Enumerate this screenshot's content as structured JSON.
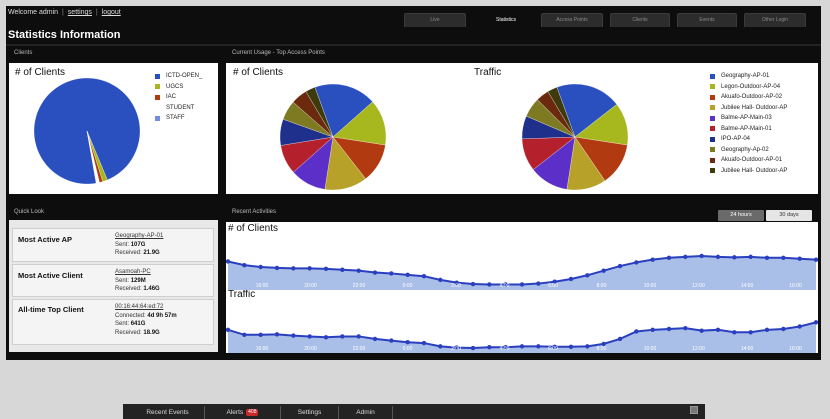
{
  "header": {
    "welcome": "Welcome admin",
    "settings_link": "settings",
    "logout_link": "logout",
    "tabs": [
      {
        "label": "Live",
        "active": false
      },
      {
        "label": "Statistics",
        "active": true
      },
      {
        "label": "Access Points",
        "active": false
      },
      {
        "label": "Clients",
        "active": false
      },
      {
        "label": "Events",
        "active": false
      },
      {
        "label": "Other Login",
        "active": false
      }
    ]
  },
  "page_title": "Statistics Information",
  "panels": {
    "clients_label": "Clients",
    "usage_label": "Current Usage - Top Access Points",
    "quicklook_label": "Quick Look",
    "recent_label": "Recent Activities"
  },
  "quick_look": [
    {
      "label": "Most Active AP",
      "link": "Geography-AP-01",
      "lines": [
        {
          "key": "Sent:",
          "value": "107G"
        },
        {
          "key": "Received:",
          "value": "21.9G"
        }
      ]
    },
    {
      "label": "Most Active Client",
      "link": "Asamoah-PC",
      "lines": [
        {
          "key": "Sent:",
          "value": "129M"
        },
        {
          "key": "Received:",
          "value": "1.46G"
        }
      ]
    },
    {
      "label": "All-time Top Client",
      "link": "00:16:44:64:ed:72",
      "lines": [
        {
          "key": "Connected:",
          "value": "4d 9h 57m"
        },
        {
          "key": "Sent:",
          "value": "641G"
        },
        {
          "key": "Received:",
          "value": "18.9G"
        }
      ]
    }
  ],
  "range_buttons": [
    {
      "label": "24 hours",
      "active": true
    },
    {
      "label": "30 days",
      "active": false
    }
  ],
  "footer": {
    "tabs": [
      "Recent Events",
      "Alerts",
      "Settings",
      "Admin"
    ],
    "alerts_badge": "408"
  },
  "chart_data": [
    {
      "type": "pie",
      "title": "# of Clients",
      "categories": [
        "ICTD-OPEN_",
        "UGCS",
        "IAC",
        "STUDENT",
        "STAFF"
      ],
      "values": [
        96.5,
        1.5,
        1.0,
        0.5,
        0.5
      ],
      "colors": [
        "#2a4fbf",
        "#a7b81e",
        "#b23a10",
        "#ffffff",
        "#ffffff"
      ],
      "legend_colors": [
        "#2a4fbf",
        "#a7b81e",
        "#b23a10",
        "#ffffff",
        "#6f8fe0"
      ],
      "legend": "right"
    },
    {
      "type": "pie",
      "title": "# of Clients",
      "values": [
        19,
        14,
        12,
        13,
        11,
        9,
        8,
        6,
        5,
        3
      ],
      "colors": [
        "#2a4fbf",
        "#a7b81e",
        "#b23a10",
        "#b8a128",
        "#5b2fc8",
        "#b4202c",
        "#1f2f8c",
        "#7e7a22",
        "#6b2a0d",
        "#3e3a0c"
      ],
      "legend": "none"
    },
    {
      "type": "pie",
      "title": "Traffic",
      "categories": [
        "Geography-AP-01",
        "Legon-Outdoor-AP-04",
        "Akuafo-Outdoor-AP-02",
        "Jubilee Hall- Outdoor-AP",
        "Balme-AP-Main-03",
        "Balme-AP-Main-01",
        "IPO-AP-04",
        "Geography-Ap-02",
        "Akuafo-Outdoor-AP-01",
        "Jubilee Hall- Outdoor-AP"
      ],
      "values": [
        20,
        13,
        13,
        12,
        12,
        10,
        7,
        6,
        4,
        3
      ],
      "colors": [
        "#2a4fbf",
        "#a7b81e",
        "#b23a10",
        "#b8a128",
        "#5b2fc8",
        "#b4202c",
        "#1f2f8c",
        "#7e7a22",
        "#6b2a0d",
        "#3e3a0c"
      ],
      "legend": "right"
    },
    {
      "type": "area",
      "title": "# of Clients",
      "x": [
        "16:00",
        "20:00",
        "22:00",
        "0:00",
        "2:00",
        "4:00",
        "6:00",
        "8:00",
        "10:00",
        "12:00",
        "14:00",
        "16:00"
      ],
      "values": [
        0.62,
        0.54,
        0.5,
        0.48,
        0.47,
        0.47,
        0.46,
        0.44,
        0.42,
        0.38,
        0.36,
        0.33,
        0.3,
        0.22,
        0.16,
        0.13,
        0.12,
        0.12,
        0.12,
        0.14,
        0.18,
        0.24,
        0.32,
        0.42,
        0.52,
        0.6,
        0.66,
        0.7,
        0.72,
        0.74,
        0.72,
        0.71,
        0.72,
        0.7,
        0.7,
        0.68,
        0.66
      ],
      "color": "#2a3fbf",
      "fill": "#a9bfe8"
    },
    {
      "type": "area",
      "title": "Traffic",
      "x": [
        "16:00",
        "20:00",
        "22:00",
        "0:00",
        "2:00",
        "4:00",
        "6:00",
        "8:00",
        "10:00",
        "12:00",
        "14:00",
        "16:00"
      ],
      "values": [
        0.56,
        0.44,
        0.44,
        0.45,
        0.42,
        0.4,
        0.38,
        0.4,
        0.4,
        0.34,
        0.3,
        0.26,
        0.24,
        0.16,
        0.13,
        0.12,
        0.14,
        0.14,
        0.16,
        0.16,
        0.15,
        0.15,
        0.16,
        0.22,
        0.34,
        0.52,
        0.56,
        0.58,
        0.6,
        0.54,
        0.56,
        0.5,
        0.5,
        0.56,
        0.58,
        0.64,
        0.74
      ],
      "color": "#2a3fbf",
      "fill": "#a9bfe8"
    }
  ]
}
